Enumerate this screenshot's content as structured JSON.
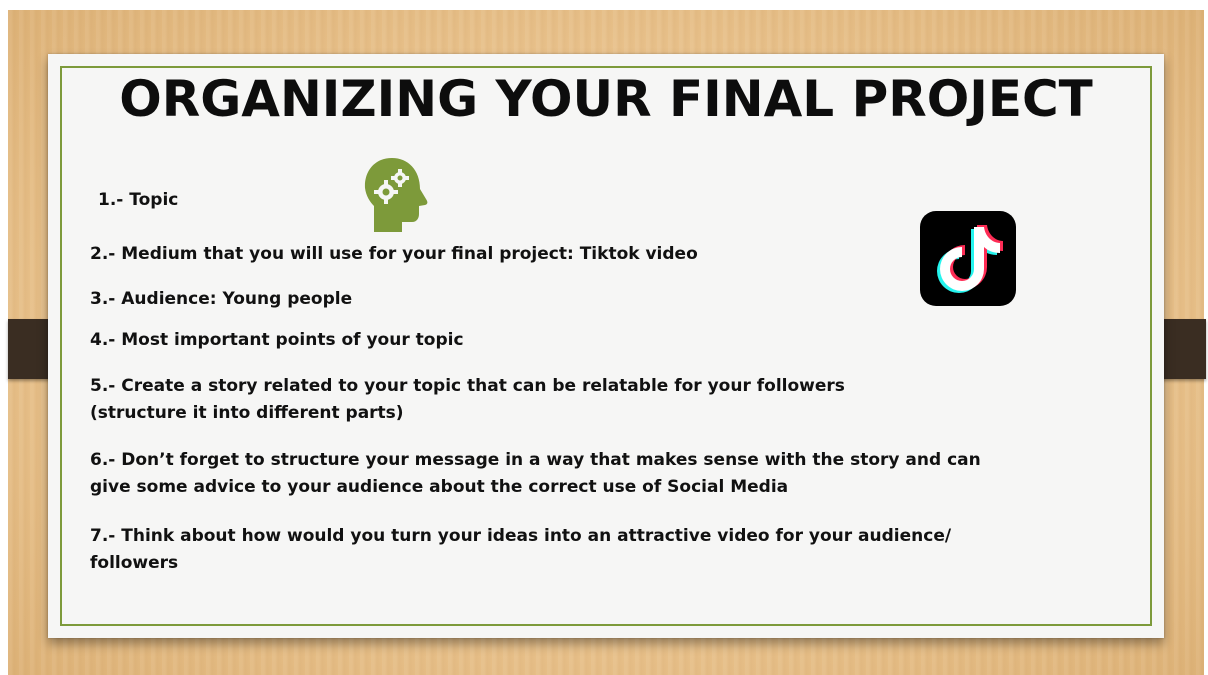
{
  "slide": {
    "title": "ORGANIZING YOUR FINAL PROJECT",
    "items": [
      {
        "number": "1.-",
        "text": "1.- Topic"
      },
      {
        "text": "2.- Medium that you will use for your final project: Tiktok video"
      },
      {
        "text": "3.- Audience: Young people"
      },
      {
        "text": "4.- Most important points of your topic"
      },
      {
        "line1": "5.- Create a story related to your topic that can be relatable for your followers",
        "line2": "(structure it into different parts)"
      },
      {
        "line1": "6.- Don’t forget to structure your message in a way that makes sense with the story and can",
        "line2": "give some advice to your audience about the correct use of Social Media"
      },
      {
        "line1": "7.- Think about how would you turn your ideas into an attractive video for your audience/",
        "line2": "followers"
      }
    ],
    "icons": [
      "head-gears-icon",
      "tiktok-logo-icon"
    ],
    "colors": {
      "frame": "#7d9a3a",
      "icon_green": "#7d9a3a",
      "wood": "#e9c28c",
      "tab": "#3a2d22"
    }
  }
}
